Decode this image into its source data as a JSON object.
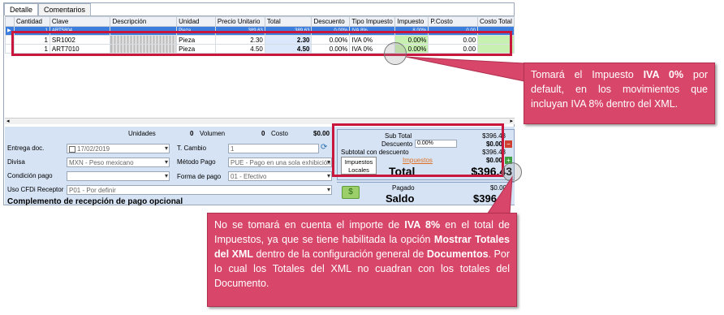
{
  "tabs": [
    "Detalle",
    "Comentarios"
  ],
  "columns": [
    "Cantidad",
    "Clave",
    "Descripción",
    "Unidad",
    "Precio Unitario",
    "Total",
    "Descuento",
    "Tipo Impuesto",
    "Impuesto",
    "P.Costo",
    "Costo Total"
  ],
  "row0": {
    "cantidad": "1",
    "clave": "ART5804",
    "unidad": "Pieza",
    "precio": "389.63",
    "total": "389.63",
    "descuento": "0.00%",
    "tipo": "IVA 8%",
    "impuesto": "8.00%",
    "pcosto": "0.00"
  },
  "rows": [
    {
      "cantidad": "1",
      "clave": "SR1002",
      "unidad": "Pieza",
      "precio": "2.30",
      "total": "2.30",
      "descuento": "0.00%",
      "tipo": "IVA 0%",
      "impuesto": "0.00%",
      "pcosto": "0.00"
    },
    {
      "cantidad": "1",
      "clave": "ART7010",
      "unidad": "Pieza",
      "precio": "4.50",
      "total": "4.50",
      "descuento": "0.00%",
      "tipo": "IVA 0%",
      "impuesto": "0.00%",
      "pcosto": "0.00"
    }
  ],
  "summary": {
    "unidades_label": "Unidades",
    "unidades": "0",
    "volumen_label": "Volumen",
    "volumen": "0",
    "costo_label": "Costo",
    "costo": "$0.00"
  },
  "form": {
    "entrega_label": "Entrega doc.",
    "entrega": "17/02/2019",
    "tcambio_label": "T. Cambio",
    "tcambio": "1",
    "divisa_label": "Divisa",
    "divisa": "MXN - Peso mexicano",
    "metodo_label": "Método Pago",
    "metodo": "PUE - Pago en una sola exhibición",
    "condicion_label": "Condición pago",
    "condicion": "",
    "forma_label": "Forma de pago",
    "forma": "01 - Efectivo",
    "cfdi_label": "Uso CFDi Receptor",
    "cfdi": "P01 - Por definir",
    "complemento": "Complemento de recepción de pago opcional"
  },
  "totals": {
    "subtotal_label": "Sub Total",
    "subtotal": "$396.43",
    "descuento_label": "Descuento",
    "descuento_pct": "0.00%",
    "descuento": "$0.00",
    "subtotal_desc_label": "Subtotal con descuento",
    "subtotal_desc": "$396.43",
    "impuestos_label": "Impuestos",
    "impuestos": "$0.00",
    "impuestos_locales": "Impuestos Locales",
    "total_label": "Total",
    "total": "$396.43",
    "pagado_label": "Pagado",
    "pagado": "$0.00",
    "saldo_label": "Saldo",
    "saldo": "$396.43"
  },
  "callout1": {
    "t1": "Tomará el Impuesto ",
    "b1": "IVA 0%",
    "t2": " por default, en los movimientos que incluyan IVA 8% dentro del XML."
  },
  "callout2": {
    "t1": "No se tomará en cuenta el importe de ",
    "b1": "IVA 8%",
    "t2": " en el total de Impuestos, ya que se tiene habilitada la opción ",
    "b2": "Mostrar Totales del XML",
    "t3": " dentro de la configuración general de ",
    "b3": "Documentos",
    "t4": ". Por lo cual los Totales del XML no cuadran con los totales del Documento."
  },
  "colors": {
    "accent_red": "#c8163c",
    "callout_bg": "#d8466a",
    "selection": "#3b7ddd",
    "green_cell": "#c8f0b0",
    "panel_bg": "#d6e3f4"
  }
}
